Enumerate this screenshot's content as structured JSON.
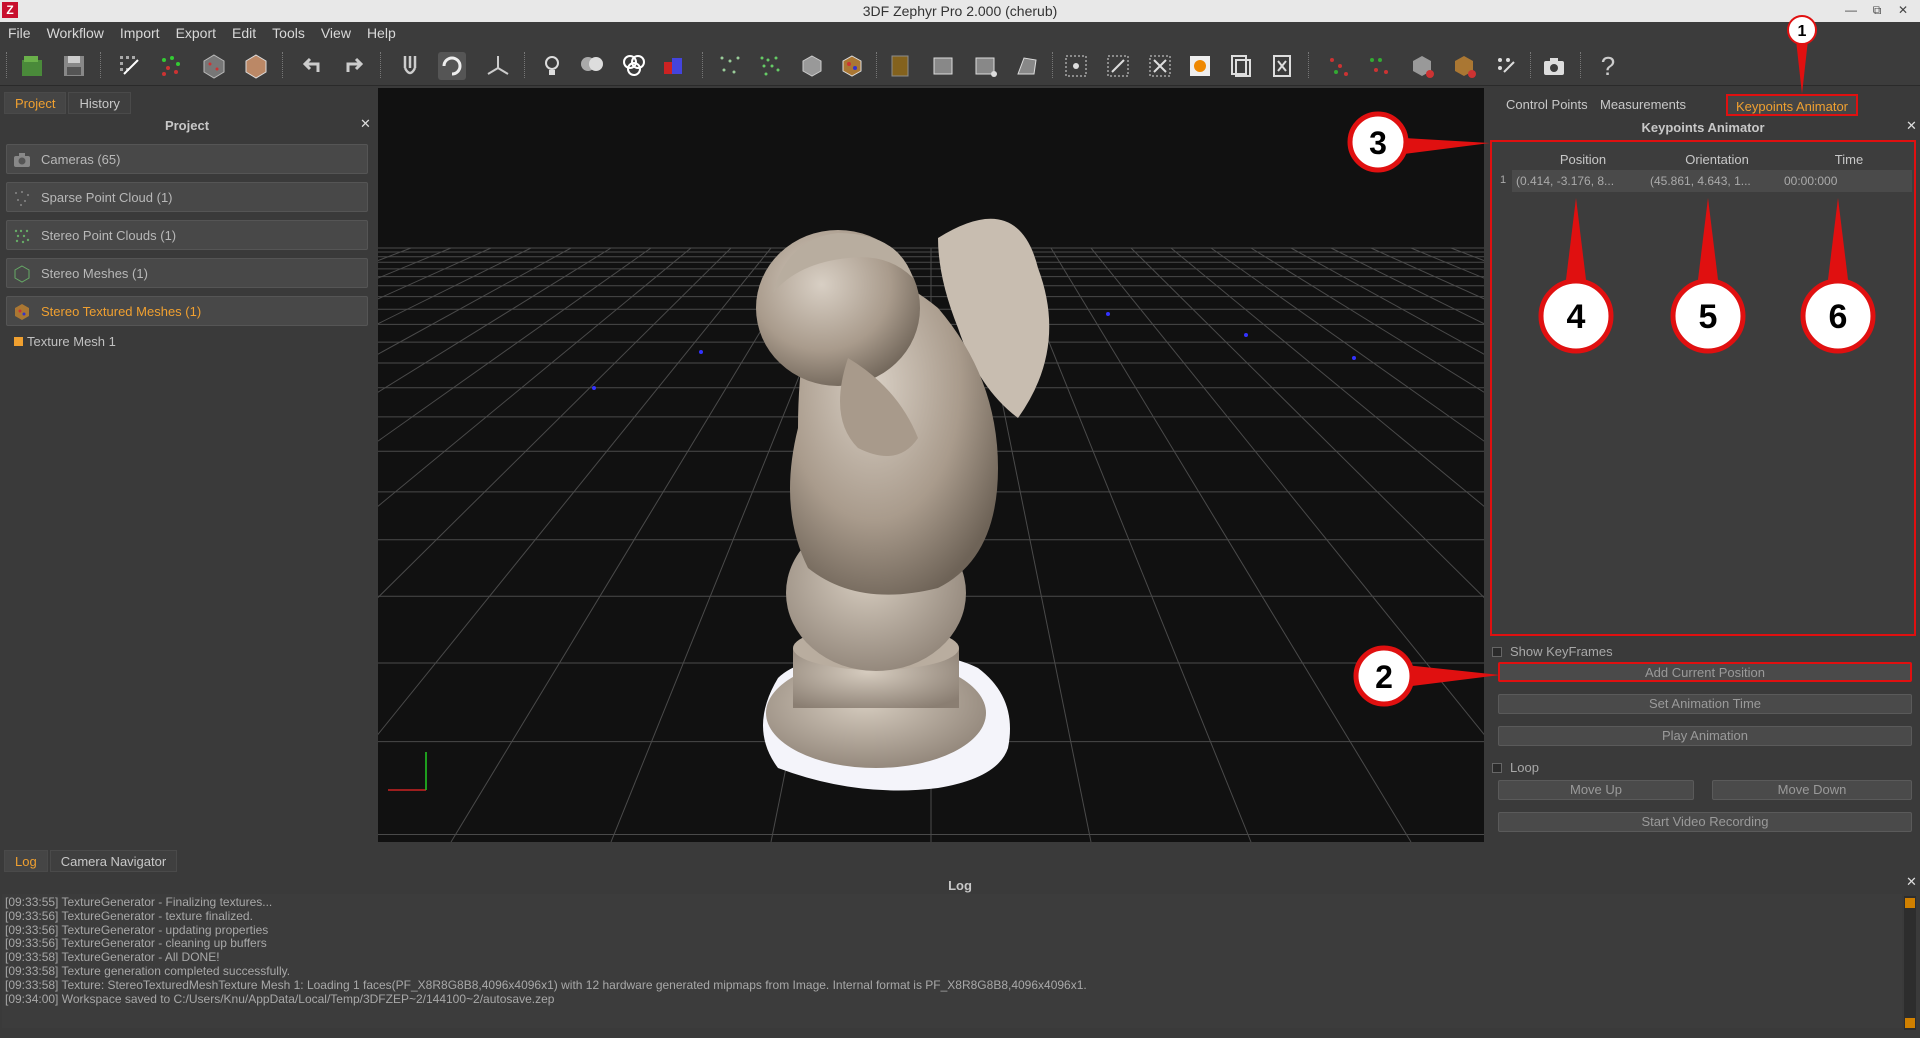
{
  "window": {
    "title": "3DF Zephyr Pro 2.000 (cherub)",
    "app_icon": "Z"
  },
  "menu": [
    "File",
    "Workflow",
    "Import",
    "Export",
    "Edit",
    "Tools",
    "View",
    "Help"
  ],
  "left_panel": {
    "tabs": [
      "Project",
      "History"
    ],
    "title": "Project",
    "items": [
      {
        "label": "Cameras (65)",
        "icon": "camera-icon"
      },
      {
        "label": "Sparse Point Cloud (1)",
        "icon": "sparse-cloud-icon"
      },
      {
        "label": "Stereo Point Clouds (1)",
        "icon": "dense-cloud-icon"
      },
      {
        "label": "Stereo Meshes (1)",
        "icon": "mesh-icon"
      },
      {
        "label": "Stereo Textured Meshes (1)",
        "icon": "textured-mesh-icon"
      }
    ],
    "subitem": "Texture Mesh 1"
  },
  "right_panel": {
    "tabs": [
      "Control Points",
      "Measurements",
      "Keypoints Animator"
    ],
    "title": "Keypoints Animator",
    "columns": [
      "Position",
      "Orientation",
      "Time"
    ],
    "rows": [
      {
        "index": "1",
        "position": "(0.414, -3.176, 8...",
        "orientation": "(45.861, 4.643, 1...",
        "time": "00:00:000"
      }
    ],
    "show_keyframes": "Show KeyFrames",
    "add_current_position": "Add Current Position",
    "set_animation_time": "Set Animation Time",
    "play_animation": "Play Animation",
    "loop": "Loop",
    "move_up": "Move Up",
    "move_down": "Move Down",
    "start_video_recording": "Start Video Recording"
  },
  "bottom_panel": {
    "tabs": [
      "Log",
      "Camera Navigator"
    ],
    "title": "Log",
    "lines": [
      "[09:33:55] TextureGenerator - Finalizing textures...",
      "[09:33:56] TextureGenerator - texture finalized.",
      "[09:33:56] TextureGenerator - updating properties",
      "[09:33:56] TextureGenerator - cleaning up buffers",
      "[09:33:58] TextureGenerator - All DONE!",
      "[09:33:58] Texture generation completed successfully.",
      "[09:33:58] Texture: StereoTexturedMeshTexture Mesh 1: Loading 1 faces(PF_X8R8G8B8,4096x4096x1) with 12 hardware generated mipmaps from Image. Internal format is PF_X8R8G8B8,4096x4096x1.",
      "[09:34:00] Workspace saved to C:/Users/Knu/AppData/Local/Temp/3DFZEP~2/144100~2/autosave.zep"
    ]
  },
  "callouts": [
    "1",
    "2",
    "3",
    "4",
    "5",
    "6"
  ],
  "colors": {
    "accent": "#f0a030",
    "annotation": "#e01010",
    "viewport_bg": "#111111",
    "panel_bg": "#3a3a3a"
  }
}
